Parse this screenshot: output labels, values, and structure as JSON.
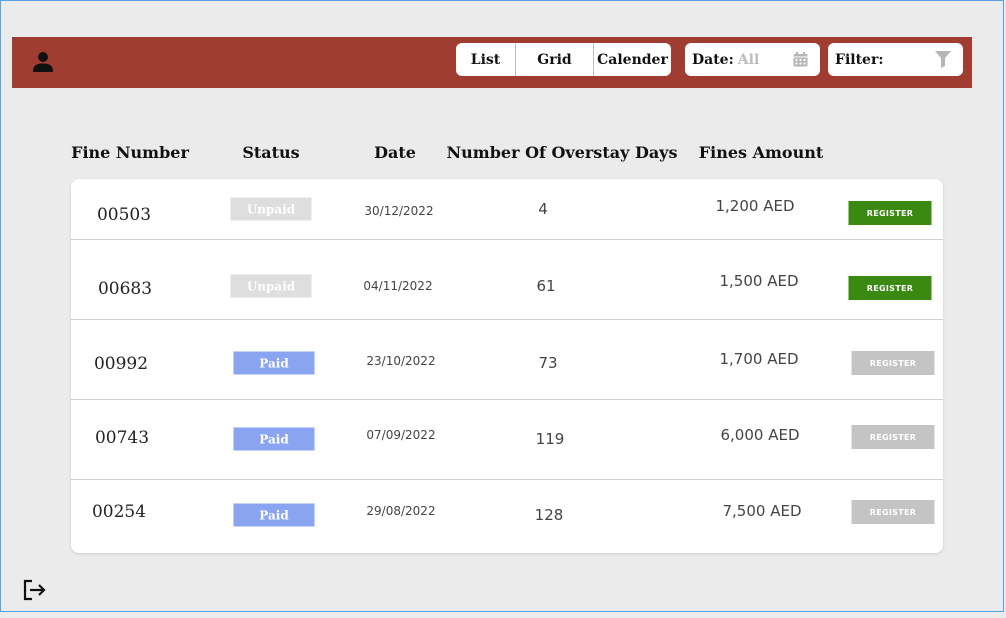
{
  "toolbar": {
    "views": [
      "List",
      "Grid",
      "Calender"
    ],
    "date_label": "Date:",
    "date_value": "All",
    "filter_label": "Filter:",
    "accent_color": "#a13c33"
  },
  "columns": [
    "Fine Number",
    "Status",
    "Date",
    "Number Of Overstay Days",
    "Fines Amount"
  ],
  "rows": [
    {
      "fine": "00503",
      "status": "Unpaid",
      "date": "30/12/2022",
      "days": "4",
      "amount": "1,200 AED",
      "action": "REGISTER",
      "action_enabled": true
    },
    {
      "fine": "00683",
      "status": "Unpaid",
      "date": "04/11/2022",
      "days": "61",
      "amount": "1,500 AED",
      "action": "REGISTER",
      "action_enabled": true
    },
    {
      "fine": "00992",
      "status": "Paid",
      "date": "23/10/2022",
      "days": "73",
      "amount": "1,700 AED",
      "action": "REGISTER",
      "action_enabled": false
    },
    {
      "fine": "00743",
      "status": "Paid",
      "date": "07/09/2022",
      "days": "119",
      "amount": "6,000 AED",
      "action": "REGISTER",
      "action_enabled": false
    },
    {
      "fine": "00254",
      "status": "Paid",
      "date": "29/08/2022",
      "days": "128",
      "amount": "7,500 AED",
      "action": "REGISTER",
      "action_enabled": false
    }
  ],
  "icons": {
    "user": "user-icon",
    "calendar": "calendar-icon",
    "filter": "filter-icon",
    "logout": "logout-icon"
  }
}
